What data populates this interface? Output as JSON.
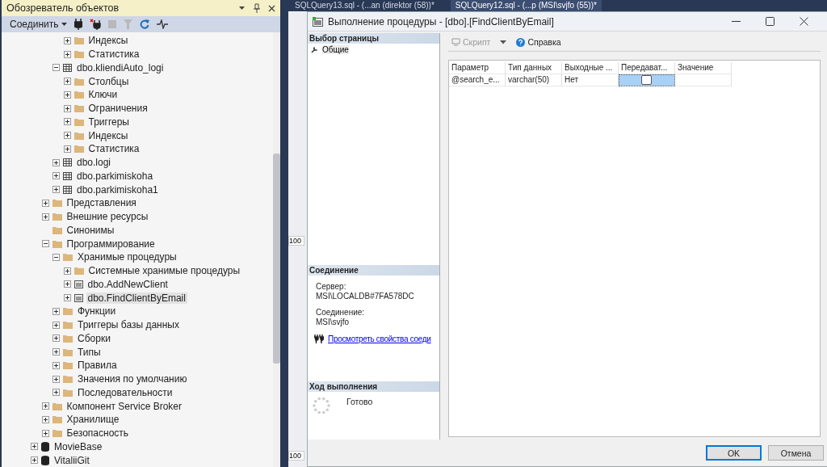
{
  "object_explorer": {
    "title": "Обозреватель объектов",
    "connect_label": "Соединить",
    "tree": [
      {
        "children": [
          {
            "children": [
              {
                "children": [
                  {
                    "label": "Индексы",
                    "kind": "folder",
                    "expanded": false,
                    "selected": false
                  },
                  {
                    "label": "Статистика",
                    "kind": "folder",
                    "expanded": false,
                    "selected": false
                  }
                ]
              },
              {
                "label": "dbo.kliendiAuto_logi",
                "kind": "table",
                "expanded": true,
                "selected": false,
                "children": [
                  {
                    "label": "Столбцы",
                    "kind": "folder",
                    "expanded": false,
                    "selected": false
                  },
                  {
                    "label": "Ключи",
                    "kind": "folder",
                    "expanded": false,
                    "selected": false
                  },
                  {
                    "label": "Ограничения",
                    "kind": "folder",
                    "expanded": false,
                    "selected": false
                  },
                  {
                    "label": "Триггеры",
                    "kind": "folder",
                    "expanded": false,
                    "selected": false
                  },
                  {
                    "label": "Индексы",
                    "kind": "folder",
                    "expanded": false,
                    "selected": false
                  },
                  {
                    "label": "Статистика",
                    "kind": "folder",
                    "expanded": false,
                    "selected": false
                  }
                ]
              },
              {
                "label": "dbo.logi",
                "kind": "table",
                "expanded": false,
                "selected": false
              },
              {
                "label": "dbo.parkimiskoha",
                "kind": "table",
                "expanded": false,
                "selected": false
              },
              {
                "label": "dbo.parkimiskoha1",
                "kind": "table",
                "expanded": false,
                "selected": false
              }
            ]
          },
          {
            "label": "Представления",
            "kind": "folder",
            "expanded": false,
            "selected": false
          },
          {
            "label": "Внешние ресурсы",
            "kind": "folder",
            "expanded": false,
            "selected": false
          },
          {
            "label": "Синонимы",
            "kind": "folder",
            "selected": false
          },
          {
            "label": "Программирование",
            "kind": "folder",
            "expanded": true,
            "selected": false,
            "children": [
              {
                "label": "Хранимые процедуры",
                "kind": "folder",
                "expanded": true,
                "selected": false,
                "children": [
                  {
                    "label": "Системные хранимые процедуры",
                    "kind": "folder",
                    "expanded": false,
                    "selected": false
                  },
                  {
                    "label": "dbo.AddNewClient",
                    "kind": "procedure",
                    "expanded": false,
                    "selected": false
                  },
                  {
                    "label": "dbo.FindClientByEmail",
                    "kind": "procedure",
                    "expanded": false,
                    "selected": true
                  }
                ]
              },
              {
                "label": "Функции",
                "kind": "folder",
                "expanded": false,
                "selected": false
              },
              {
                "label": "Триггеры базы данных",
                "kind": "folder",
                "expanded": false,
                "selected": false
              },
              {
                "label": "Сборки",
                "kind": "folder",
                "expanded": false,
                "selected": false
              },
              {
                "label": "Типы",
                "kind": "folder",
                "expanded": false,
                "selected": false
              },
              {
                "label": "Правила",
                "kind": "folder",
                "expanded": false,
                "selected": false
              },
              {
                "label": "Значения по умолчанию",
                "kind": "folder",
                "expanded": false,
                "selected": false
              },
              {
                "label": "Последовательности",
                "kind": "folder",
                "expanded": false,
                "selected": false
              }
            ]
          },
          {
            "label": "Компонент Service Broker",
            "kind": "folder",
            "expanded": false,
            "selected": false
          },
          {
            "label": "Хранилище",
            "kind": "folder",
            "expanded": false,
            "selected": false
          },
          {
            "label": "Безопасность",
            "kind": "folder",
            "expanded": false,
            "selected": false
          }
        ]
      },
      {
        "label": "MovieBase",
        "kind": "database",
        "expanded": false,
        "selected": false
      },
      {
        "label": "VitaliiGit",
        "kind": "database",
        "expanded": false,
        "selected": false
      }
    ]
  },
  "editor_tabs": [
    {
      "label": "SQLQuery13.sql - (...an (direktor (58))*",
      "selected": false
    },
    {
      "label": "SQLQuery12.sql - (...p (MSI\\svjfo (55))*",
      "selected": true
    }
  ],
  "editor_zoom": [
    "100",
    "100"
  ],
  "dialog": {
    "title": "Выполнение процедуры - [dbo].[FindClientByEmail]",
    "pages_header": "Выбор страницы",
    "pages": [
      {
        "label": "Общие",
        "selected": true
      }
    ],
    "connection_header": "Соединение",
    "server_label": "Сервер:",
    "server": "MSI\\LOCALDB#7FA578DC",
    "connection_label": "Соединение:",
    "connection": "MSI\\svjfo",
    "properties_link": "Просмотреть свойства соеди",
    "progress_header": "Ход выполнения",
    "progress_status": "Готово",
    "toolbar": {
      "script": {
        "label": "Скрипт",
        "disabled": true
      },
      "help": "Справка"
    },
    "grid": {
      "columns": [
        "Параметр",
        "Тип данных",
        "Выходные ...",
        "Передават...",
        "Значение"
      ],
      "rows": [
        {
          "cells": [
            {
              "kind": "text",
              "text": "@search_e..."
            },
            {
              "kind": "text",
              "text": "varchar(50)"
            },
            {
              "kind": "text",
              "text": "Нет"
            },
            {
              "kind": "checkbox",
              "checked": false,
              "selected": true
            },
            {
              "kind": "empty"
            }
          ]
        }
      ]
    },
    "buttons": [
      {
        "label": "OK",
        "default": true
      },
      {
        "label": "Отмена",
        "default": false
      }
    ]
  }
}
